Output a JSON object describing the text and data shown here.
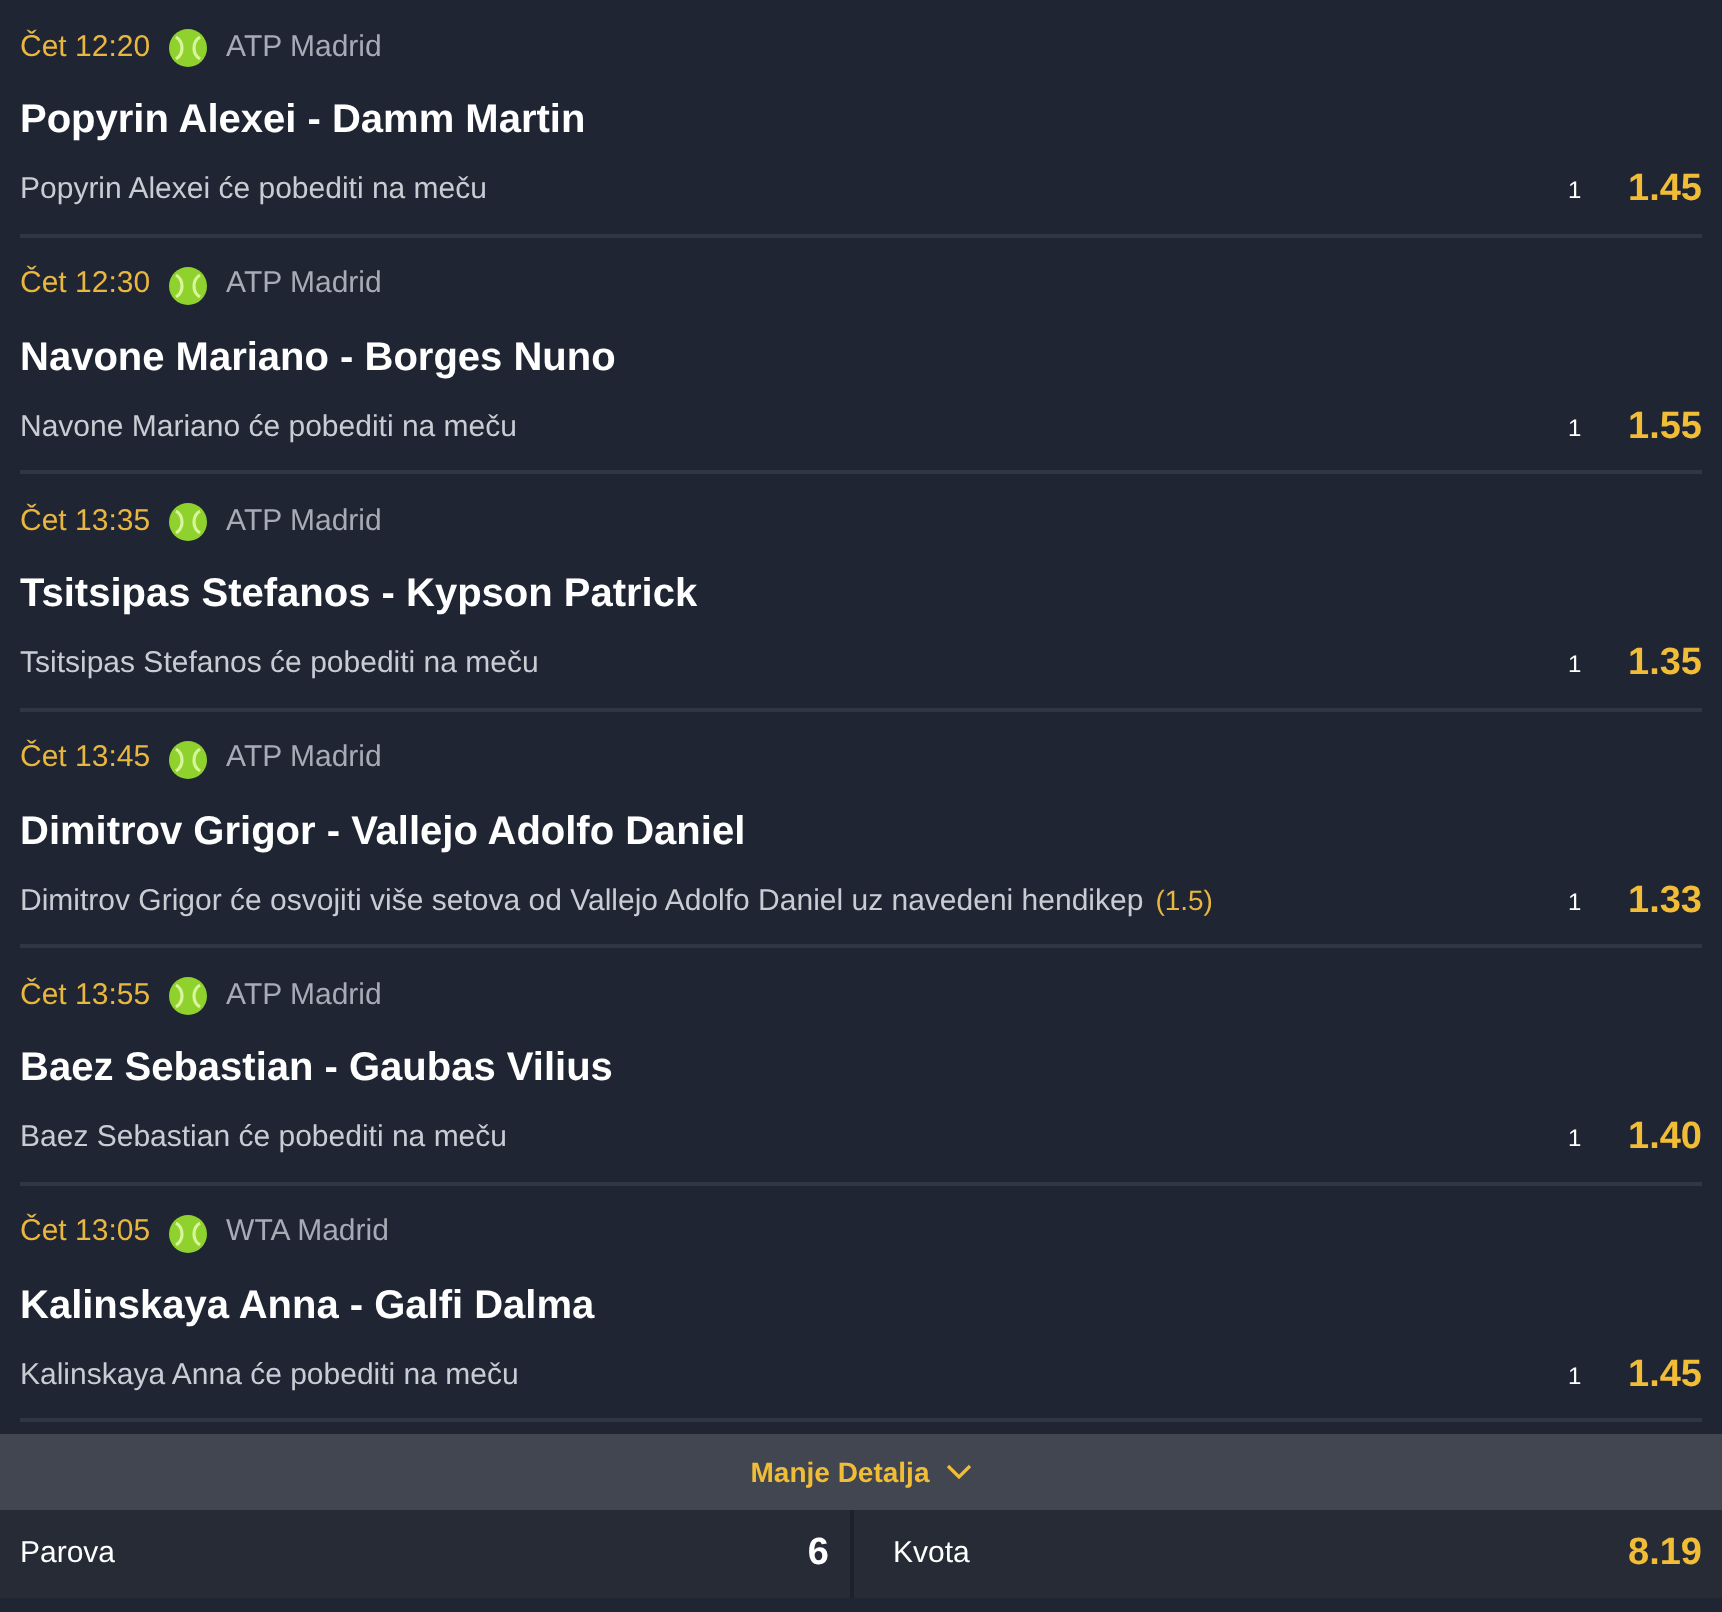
{
  "matches": [
    {
      "time": "Čet 12:20",
      "league": "ATP Madrid",
      "title": "Popyrin Alexei - Damm Martin",
      "pick": "Popyrin Alexei će pobediti na meču",
      "outcome": "1",
      "odds": "1.45"
    },
    {
      "time": "Čet 12:30",
      "league": "ATP Madrid",
      "title": "Navone Mariano - Borges Nuno",
      "pick": "Navone Mariano će pobediti na meču",
      "outcome": "1",
      "odds": "1.55"
    },
    {
      "time": "Čet 13:35",
      "league": "ATP Madrid",
      "title": "Tsitsipas Stefanos - Kypson Patrick",
      "pick": "Tsitsipas Stefanos će pobediti na meču",
      "outcome": "1",
      "odds": "1.35"
    },
    {
      "time": "Čet 13:45",
      "league": "ATP Madrid",
      "title": "Dimitrov Grigor - Vallejo Adolfo Daniel",
      "pick": "Dimitrov Grigor će osvojiti više setova od Vallejo Adolfo Daniel uz navedeni hendikep",
      "handicap": "(1.5)",
      "outcome": "1",
      "odds": "1.33"
    },
    {
      "time": "Čet 13:55",
      "league": "ATP Madrid",
      "title": "Baez Sebastian - Gaubas Vilius",
      "pick": "Baez Sebastian će pobediti na meču",
      "outcome": "1",
      "odds": "1.40"
    },
    {
      "time": "Čet 13:05",
      "league": "WTA Madrid",
      "title": "Kalinskaya Anna - Galfi Dalma",
      "pick": "Kalinskaya Anna će pobediti na meču",
      "outcome": "1",
      "odds": "1.45"
    }
  ],
  "toggle": {
    "label": "Manje Detalja",
    "expanded": true
  },
  "summary": {
    "pairs_label": "Parova",
    "pairs": "6",
    "odds_label": "Kvota",
    "odds": "8.19"
  }
}
